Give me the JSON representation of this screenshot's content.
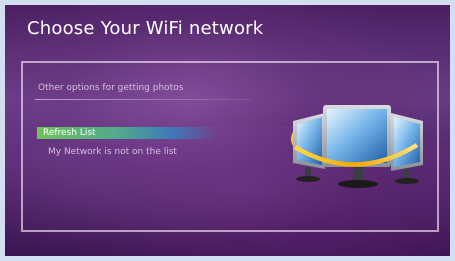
{
  "window": {
    "title": "Choose Your WiFi network"
  },
  "options_panel": {
    "section_label": "Other options for getting photos",
    "items": [
      {
        "label": "Refresh List",
        "selected": true
      },
      {
        "label": "My Network is not on the list",
        "selected": false
      }
    ]
  },
  "illustration": {
    "icon": "monitors-network-icon"
  },
  "colors": {
    "background": "#5c2f77",
    "selection_start": "#6fc15a",
    "selection_end": "#3e79b8",
    "panel_border": "#ebd7f0"
  }
}
